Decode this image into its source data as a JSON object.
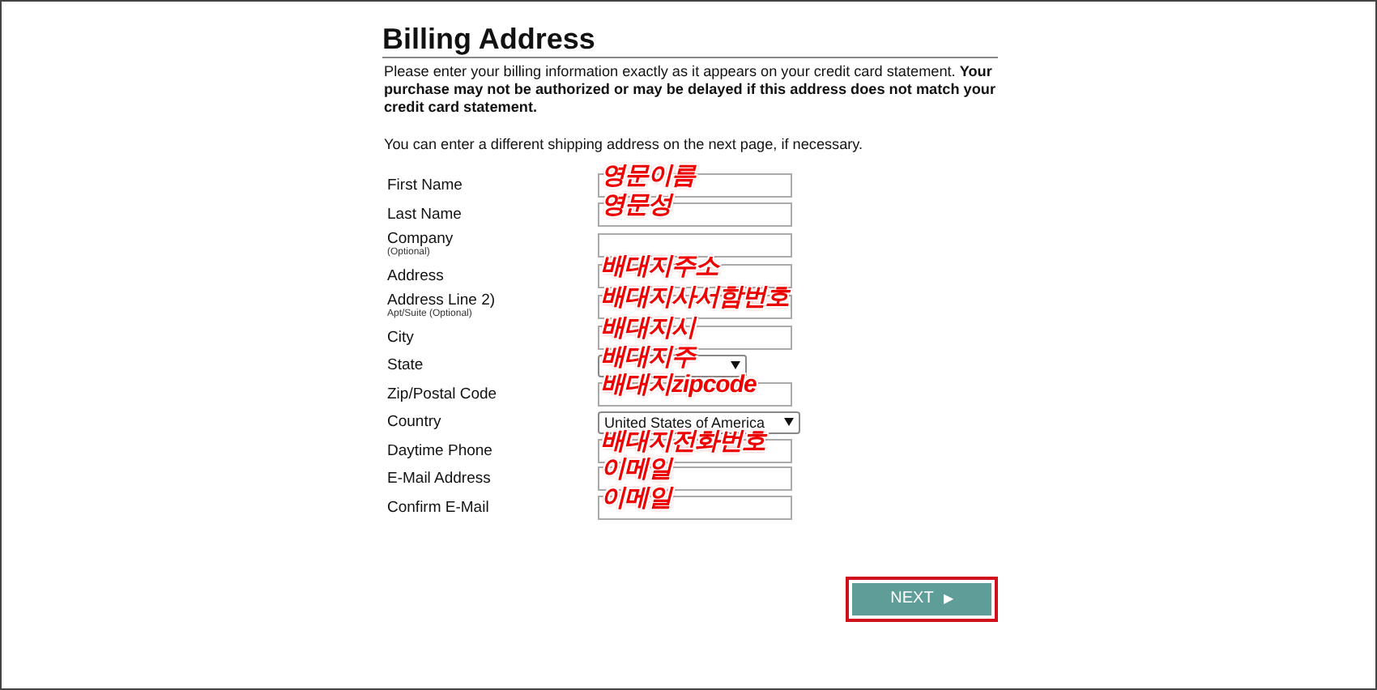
{
  "title": "Billing Address",
  "intro": "Please enter your billing information exactly as it appears on your credit card statement. **Your purchase may not be authorized or may be delayed if this address does not match your credit card statement.**",
  "note": "You can enter a different shipping address on the next page, if necessary.",
  "fields": [
    {
      "label": "First Name",
      "kind": "text",
      "annotation": "영문이름"
    },
    {
      "label": "Last Name",
      "kind": "text",
      "annotation": "영문성"
    },
    {
      "label": "Company",
      "sublabel": "(Optional)",
      "kind": "text"
    },
    {
      "label": "Address",
      "kind": "text",
      "annotation": "배대지주소"
    },
    {
      "label": "Address Line 2)",
      "sublabel": "Apt/Suite (Optional)",
      "kind": "text",
      "annotation": "배대지사서함번호"
    },
    {
      "label": "City",
      "kind": "text",
      "annotation": "배대지시"
    },
    {
      "label": "State",
      "kind": "state-select",
      "annotation": "배대지주"
    },
    {
      "label": "Zip/Postal Code",
      "kind": "text",
      "annotation": "배대지zipcode"
    },
    {
      "label": "Country",
      "kind": "country-select",
      "value": "United States of America"
    },
    {
      "label": "Daytime Phone",
      "kind": "text",
      "annotation": "배대지전화번호"
    },
    {
      "label": "E-Mail Address",
      "kind": "text",
      "annotation": "이메일"
    },
    {
      "label": "Confirm E-Mail",
      "kind": "text",
      "annotation": "이메일"
    }
  ],
  "next_button": {
    "label": "NEXT",
    "icon": "▶",
    "highlighted": true
  }
}
